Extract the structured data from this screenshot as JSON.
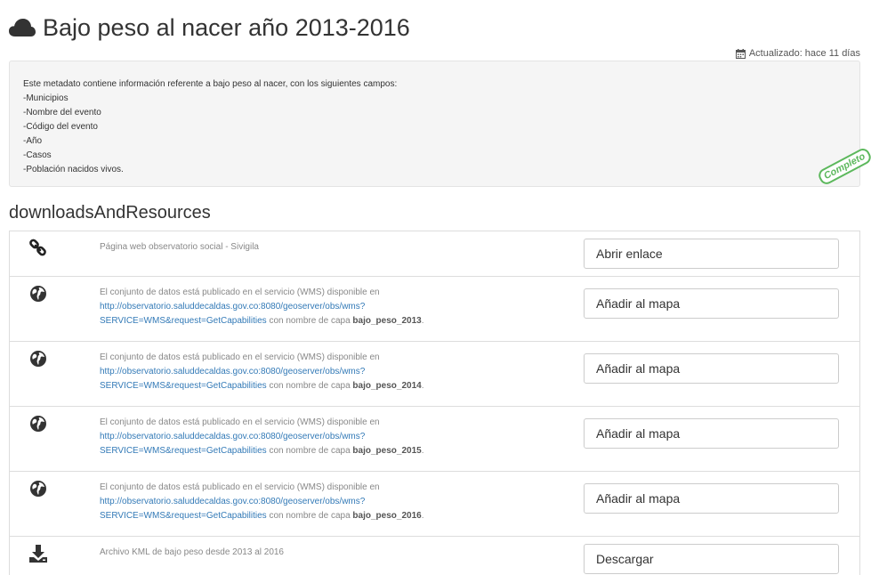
{
  "title": "Bajo peso al nacer año 2013-2016",
  "updated": "Actualizado: hace 11 días",
  "abstract": {
    "lines": [
      "Este metadato contiene información referente a bajo peso al nacer, con los siguientes campos:",
      "-Municipios",
      "-Nombre del evento",
      "-Código del evento",
      "-Año",
      "-Casos",
      "-Población nacidos vivos."
    ]
  },
  "status_stamp": "Completo",
  "section_title": "downloadsAndResources",
  "resources": [
    {
      "icon": "link-icon",
      "text": "Página web observatorio social - Sivigila",
      "button": "Abrir enlace"
    },
    {
      "icon": "globe-icon",
      "text_prefix": "El conjunto de datos está publicado en el servicio (WMS) disponible en",
      "link_line1": "http://observatorio.saluddecaldas.gov.co:8080/geoserver/obs/wms?",
      "link_line2": "SERVICE=WMS&request=GetCapabilities",
      "layer_prefix": " con nombre de capa ",
      "layer": "bajo_peso_2013",
      "suffix": ".",
      "button": "Añadir al mapa"
    },
    {
      "icon": "globe-icon",
      "text_prefix": "El conjunto de datos está publicado en el servicio (WMS) disponible en",
      "link_line1": "http://observatorio.saluddecaldas.gov.co:8080/geoserver/obs/wms?",
      "link_line2": "SERVICE=WMS&request=GetCapabilities",
      "layer_prefix": " con nombre de capa ",
      "layer": "bajo_peso_2014",
      "suffix": ".",
      "button": "Añadir al mapa"
    },
    {
      "icon": "globe-icon",
      "text_prefix": "El conjunto de datos está publicado en el servicio (WMS) disponible en",
      "link_line1": "http://observatorio.saluddecaldas.gov.co:8080/geoserver/obs/wms?",
      "link_line2": "SERVICE=WMS&request=GetCapabilities",
      "layer_prefix": " con nombre de capa ",
      "layer": "bajo_peso_2015",
      "suffix": ".",
      "button": "Añadir al mapa"
    },
    {
      "icon": "globe-icon",
      "text_prefix": "El conjunto de datos está publicado en el servicio (WMS) disponible en",
      "link_line1": "http://observatorio.saluddecaldas.gov.co:8080/geoserver/obs/wms?",
      "link_line2": "SERVICE=WMS&request=GetCapabilities",
      "layer_prefix": " con nombre de capa ",
      "layer": "bajo_peso_2016",
      "suffix": ".",
      "button": "Añadir al mapa"
    },
    {
      "icon": "download-icon",
      "text": "Archivo KML de bajo peso desde 2013 al 2016",
      "button": "Descargar"
    }
  ],
  "colors": {
    "link": "#337ab7",
    "stamp": "#5cb85c",
    "abstract_bg": "#f5f5f5"
  }
}
